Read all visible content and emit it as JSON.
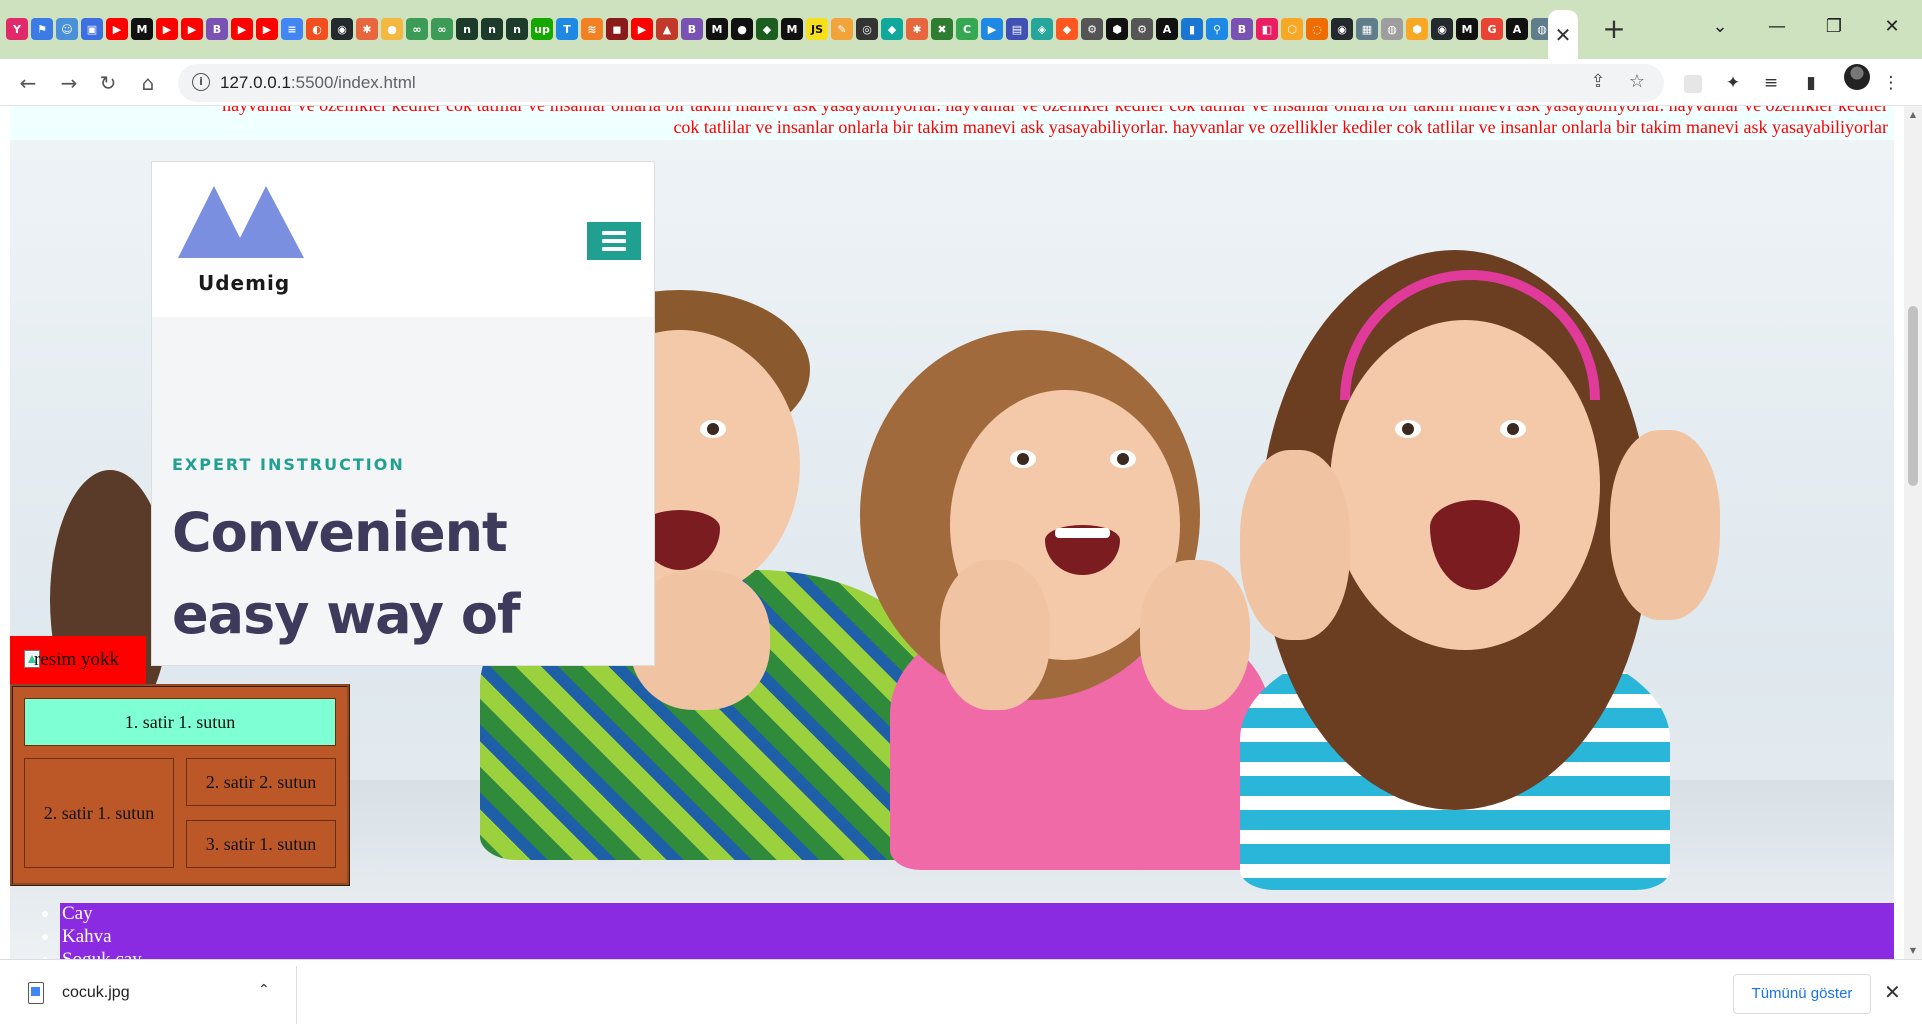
{
  "browser": {
    "tab_favicons": [
      {
        "name": "yahoo-favicon",
        "color": "#e02a6a",
        "glyph": "Y"
      },
      {
        "name": "flag-favicon",
        "color": "#3b7be6",
        "glyph": "⚑"
      },
      {
        "name": "people-favicon",
        "color": "#4a90d9",
        "glyph": "☺"
      },
      {
        "name": "contacts-favicon",
        "color": "#3d6fe0",
        "glyph": "▣"
      },
      {
        "name": "youtube-favicon",
        "color": "#ff0000",
        "glyph": "▶"
      },
      {
        "name": "medium-favicon",
        "color": "#111111",
        "glyph": "M"
      },
      {
        "name": "youtube-favicon",
        "color": "#ff0000",
        "glyph": "▶"
      },
      {
        "name": "youtube-favicon",
        "color": "#ff0000",
        "glyph": "▶"
      },
      {
        "name": "bold-favicon",
        "color": "#7952b3",
        "glyph": "B"
      },
      {
        "name": "youtube-favicon",
        "color": "#ff0000",
        "glyph": "▶"
      },
      {
        "name": "youtube-favicon",
        "color": "#ff0000",
        "glyph": "▶"
      },
      {
        "name": "docs-favicon",
        "color": "#4285f4",
        "glyph": "≡"
      },
      {
        "name": "figma-favicon",
        "color": "#f24e1e",
        "glyph": "◐"
      },
      {
        "name": "github-favicon",
        "color": "#24292e",
        "glyph": "◉"
      },
      {
        "name": "asterisk-favicon",
        "color": "#e8663d",
        "glyph": "✱"
      },
      {
        "name": "dot-favicon",
        "color": "#f4b740",
        "glyph": "●"
      },
      {
        "name": "link-favicon",
        "color": "#3c9b57",
        "glyph": "∞"
      },
      {
        "name": "link-favicon",
        "color": "#3c9b57",
        "glyph": "∞"
      },
      {
        "name": "n-favicon",
        "color": "#1d3b2a",
        "glyph": "n"
      },
      {
        "name": "n-favicon",
        "color": "#1d3b2a",
        "glyph": "n"
      },
      {
        "name": "n-favicon",
        "color": "#1d3b2a",
        "glyph": "n"
      },
      {
        "name": "upwork-favicon",
        "color": "#14a800",
        "glyph": "up"
      },
      {
        "name": "tt-favicon",
        "color": "#1e88e5",
        "glyph": "T"
      },
      {
        "name": "stack-favicon",
        "color": "#f48024",
        "glyph": "≋"
      },
      {
        "name": "red-favicon",
        "color": "#8b1a1a",
        "glyph": "◼"
      },
      {
        "name": "youtube-favicon",
        "color": "#ff0000",
        "glyph": "▶"
      },
      {
        "name": "book-favicon",
        "color": "#c0392b",
        "glyph": "▲"
      },
      {
        "name": "bold-favicon",
        "color": "#7952b3",
        "glyph": "B"
      },
      {
        "name": "medium-favicon",
        "color": "#111111",
        "glyph": "M"
      },
      {
        "name": "medium-favicon",
        "color": "#111111",
        "glyph": "●"
      },
      {
        "name": "leaf-favicon",
        "color": "#1b5e20",
        "glyph": "◆"
      },
      {
        "name": "medium-favicon",
        "color": "#111111",
        "glyph": "M"
      },
      {
        "name": "js-favicon",
        "color": "#f7df1e",
        "glyph": "JS"
      },
      {
        "name": "feather-favicon",
        "color": "#f2a33a",
        "glyph": "✎"
      },
      {
        "name": "circle-favicon",
        "color": "#333333",
        "glyph": "◎"
      },
      {
        "name": "diamond-favicon",
        "color": "#0fa89a",
        "glyph": "◆"
      },
      {
        "name": "asterisk-favicon",
        "color": "#e8663d",
        "glyph": "✱"
      },
      {
        "name": "tools-favicon",
        "color": "#2e7d32",
        "glyph": "✖"
      },
      {
        "name": "c-favicon",
        "color": "#34a853",
        "glyph": "C"
      },
      {
        "name": "play-favicon",
        "color": "#1e88e5",
        "glyph": "▶"
      },
      {
        "name": "news-favicon",
        "color": "#3f51b5",
        "glyph": "▤"
      },
      {
        "name": "drop-favicon",
        "color": "#26a69a",
        "glyph": "◈"
      },
      {
        "name": "arrow-favicon",
        "color": "#ff5722",
        "glyph": "◆"
      },
      {
        "name": "gear-favicon",
        "color": "#555555",
        "glyph": "⚙"
      },
      {
        "name": "hex-favicon",
        "color": "#111111",
        "glyph": "⬢"
      },
      {
        "name": "gear-favicon",
        "color": "#555555",
        "glyph": "⚙"
      },
      {
        "name": "a-favicon",
        "color": "#111111",
        "glyph": "A"
      },
      {
        "name": "blue-favicon",
        "color": "#1976d2",
        "glyph": "▮"
      },
      {
        "name": "pin-favicon",
        "color": "#1e88e5",
        "glyph": "⚲"
      },
      {
        "name": "bold-favicon",
        "color": "#7952b3",
        "glyph": "B"
      },
      {
        "name": "pink-favicon",
        "color": "#e91e63",
        "glyph": "◧"
      },
      {
        "name": "orange-favicon",
        "color": "#f9a825",
        "glyph": "⬡"
      },
      {
        "name": "ring-favicon",
        "color": "#ef6c00",
        "glyph": "◌"
      },
      {
        "name": "github-favicon",
        "color": "#24292e",
        "glyph": "◉"
      },
      {
        "name": "grid-favicon",
        "color": "#607d8b",
        "glyph": "▦"
      },
      {
        "name": "globe-favicon",
        "color": "#9e9e9e",
        "glyph": "◍"
      },
      {
        "name": "hex-favicon",
        "color": "#f9a825",
        "glyph": "⬢"
      },
      {
        "name": "github-favicon",
        "color": "#24292e",
        "glyph": "◉"
      },
      {
        "name": "medium-favicon",
        "color": "#111111",
        "glyph": "M"
      },
      {
        "name": "google-favicon",
        "color": "#ea4335",
        "glyph": "G"
      },
      {
        "name": "a-favicon",
        "color": "#111111",
        "glyph": "A"
      },
      {
        "name": "globe-favicon",
        "color": "#607d8b",
        "glyph": "◍"
      }
    ],
    "active_tab_close": "✕",
    "new_tab": "+",
    "tab_search": "⌄",
    "minimize": "—",
    "restore": "❐",
    "close": "✕",
    "url_host": "127.0.0.1",
    "url_rest": ":5500/index.html",
    "back": "←",
    "forward": "→",
    "reload": "↻",
    "home": "⌂",
    "info_glyph": "i",
    "share": "⇪",
    "bookmark": "☆",
    "extensions": "✦",
    "media": "≡",
    "sidepanel": "▮",
    "menu": "⋮"
  },
  "page": {
    "marquee_line1": "hayvanlar ve ozellikler kediler cok tatlilar ve insanlar onlarla bir takim manevi ask yasayabiliyorlar. hayvanlar ve ozellikler kediler cok tatlilar ve insanlar onlarla bir takim manevi ask yasayabiliyorlar. hayvanlar ve ozellikler kediler",
    "marquee_line2": "cok tatlilar ve insanlar onlarla bir takim manevi ask yasayabiliyorlar. hayvanlar ve ozellikler kediler cok tatlilar ve insanlar onlarla bir takim manevi ask yasayabiliyorlar",
    "marquee_color": "#ff0000",
    "brand": "Udemig",
    "logo_color": "#7b8fe0",
    "accent": "#20a090",
    "kicker": "EXPERT INSTRUCTION",
    "headline": "Convenient easy way of learning new skills!",
    "broken_image_alt": "resim yokk",
    "table": {
      "r1c1": "1. satir 1. sutun",
      "r2c1": "2. satir 1. sutun",
      "r2c2": "2. satir 2. sutun",
      "r3c1": "3. satir 1. sutun"
    },
    "list": [
      "Cay",
      "Kahva",
      "Soguk cay"
    ]
  },
  "downloads": {
    "file_name": "cocuk.jpg",
    "chevron": "⌃",
    "show_all": "Tümünü göster",
    "close": "✕"
  }
}
